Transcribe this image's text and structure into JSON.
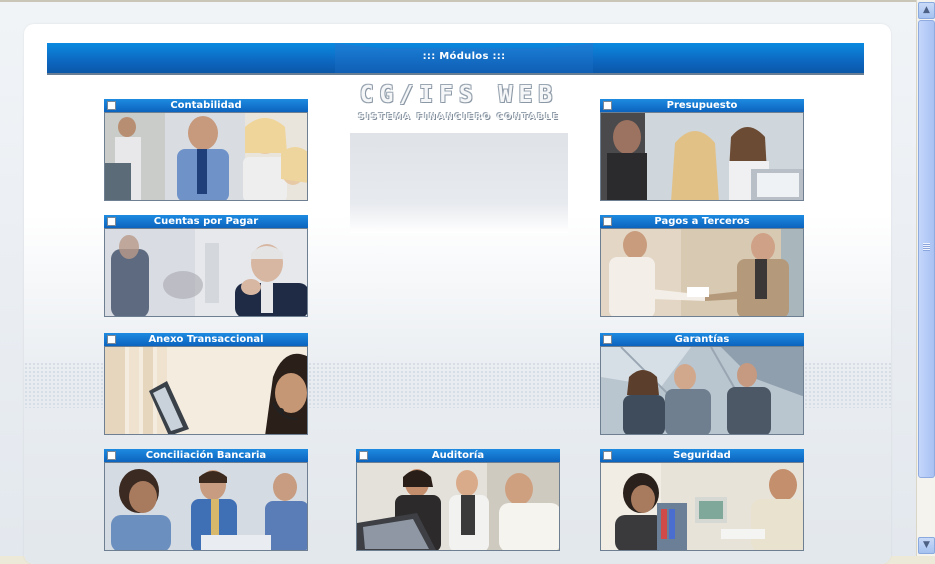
{
  "header": {
    "title": "::: Módulos :::"
  },
  "brand": {
    "title": "CG/IFS WEB",
    "subtitle": "SISTEMA FINANCIERO CONTABLE"
  },
  "modules": [
    {
      "label": "Contabilidad"
    },
    {
      "label": "Presupuesto"
    },
    {
      "label": "Cuentas por Pagar"
    },
    {
      "label": "Pagos a Terceros"
    },
    {
      "label": "Anexo Transaccional"
    },
    {
      "label": "Garantías"
    },
    {
      "label": "Conciliación Bancaria"
    },
    {
      "label": "Auditoría"
    },
    {
      "label": "Seguridad"
    }
  ],
  "scrollbar": {
    "up_icon": "▲",
    "down_icon": "▼"
  },
  "colors": {
    "header_blue": "#0d67c0",
    "module_blue": "#1e8be0",
    "panel": "#ffffff"
  }
}
